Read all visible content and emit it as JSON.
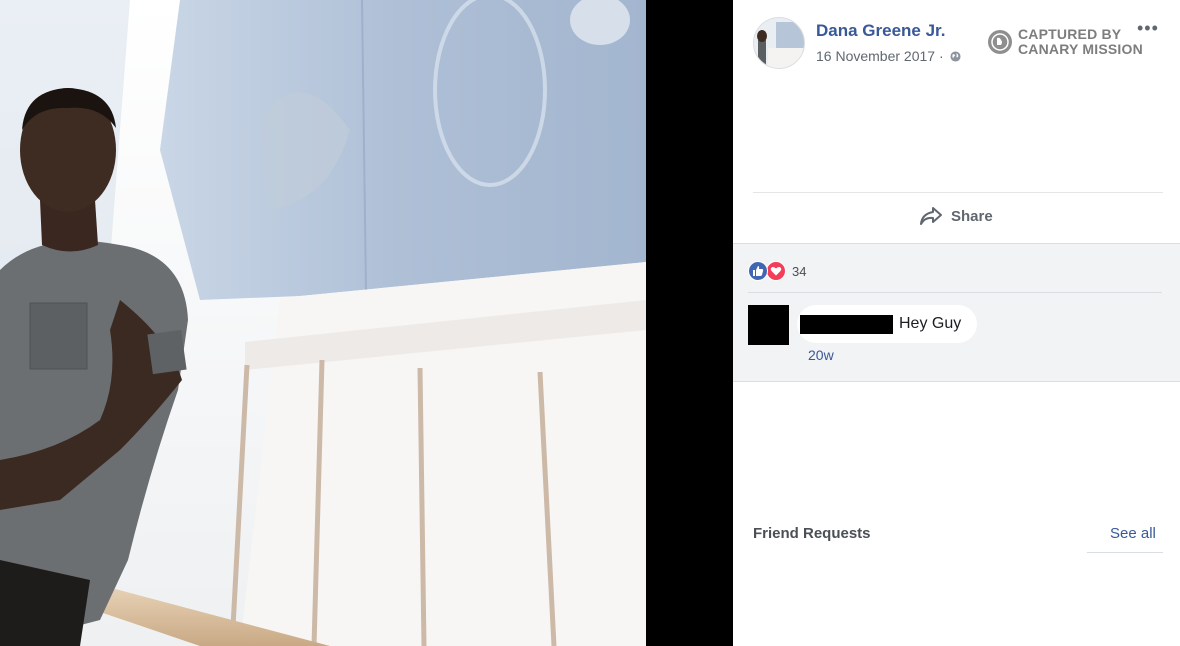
{
  "post": {
    "author": "Dana Greene Jr.",
    "date": "16 November 2017",
    "separator": "·",
    "privacy_icon": "globe-icon",
    "more_icon": "ellipsis-icon"
  },
  "watermark": {
    "line1": "CAPTURED BY",
    "line2": "CANARY MISSION",
    "icon": "canary-logo-icon"
  },
  "actions": {
    "share_label": "Share",
    "share_icon": "share-arrow-icon"
  },
  "reactions": {
    "count": "34",
    "icons": [
      "like-reaction-icon",
      "love-reaction-icon"
    ],
    "like_color": "#4267b2",
    "love_color": "#f33e58"
  },
  "comment": {
    "text": "Hey Guy",
    "time": "20w"
  },
  "friend_requests": {
    "title": "Friend Requests",
    "see_all": "See all"
  },
  "colors": {
    "link_blue": "#385898",
    "panel_gray": "#f2f3f5",
    "black_bar": "#000000"
  }
}
